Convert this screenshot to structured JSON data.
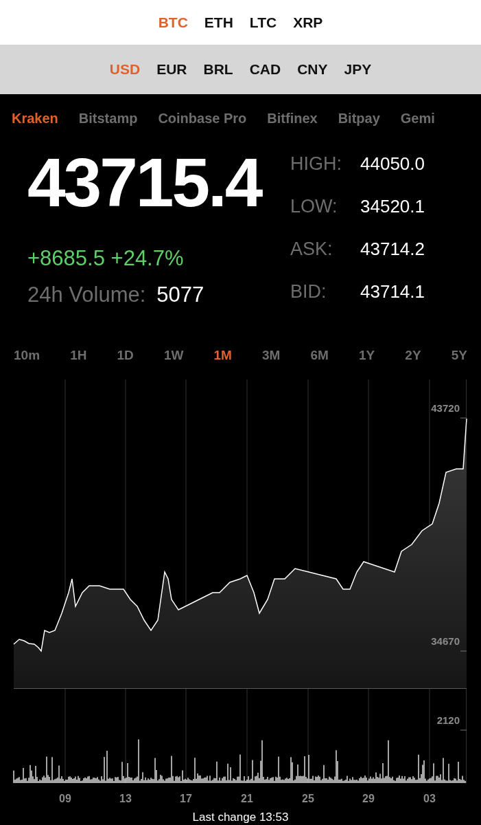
{
  "coins": [
    {
      "label": "BTC",
      "selected": true
    },
    {
      "label": "ETH",
      "selected": false
    },
    {
      "label": "LTC",
      "selected": false
    },
    {
      "label": "XRP",
      "selected": false
    }
  ],
  "currencies": [
    {
      "label": "USD",
      "selected": true
    },
    {
      "label": "EUR",
      "selected": false
    },
    {
      "label": "BRL",
      "selected": false
    },
    {
      "label": "CAD",
      "selected": false
    },
    {
      "label": "CNY",
      "selected": false
    },
    {
      "label": "JPY",
      "selected": false
    }
  ],
  "exchanges": [
    {
      "label": "Kraken",
      "selected": true
    },
    {
      "label": "Bitstamp",
      "selected": false
    },
    {
      "label": "Coinbase Pro",
      "selected": false
    },
    {
      "label": "Bitfinex",
      "selected": false
    },
    {
      "label": "Bitpay",
      "selected": false
    },
    {
      "label": "Gemi",
      "selected": false
    }
  ],
  "price": "43715.4",
  "change": "+8685.5 +24.7%",
  "volume": {
    "label": "24h Volume:",
    "value": "5077"
  },
  "stats": [
    {
      "label": "HIGH:",
      "value": "44050.0"
    },
    {
      "label": "LOW:",
      "value": "34520.1"
    },
    {
      "label": "ASK:",
      "value": "43714.2"
    },
    {
      "label": "BID:",
      "value": "43714.1"
    }
  ],
  "timeframes": [
    {
      "label": "10m",
      "selected": false
    },
    {
      "label": "1H",
      "selected": false
    },
    {
      "label": "1D",
      "selected": false
    },
    {
      "label": "1W",
      "selected": false
    },
    {
      "label": "1M",
      "selected": true
    },
    {
      "label": "3M",
      "selected": false
    },
    {
      "label": "6M",
      "selected": false
    },
    {
      "label": "1Y",
      "selected": false
    },
    {
      "label": "2Y",
      "selected": false
    },
    {
      "label": "5Y",
      "selected": false
    }
  ],
  "price_chart": {
    "y_labels": [
      "43720",
      "34670"
    ]
  },
  "volume_chart": {
    "max_label": "2120"
  },
  "date_labels": [
    "09",
    "13",
    "17",
    "21",
    "25",
    "29",
    "03"
  ],
  "footer": "Last change 13:53"
}
